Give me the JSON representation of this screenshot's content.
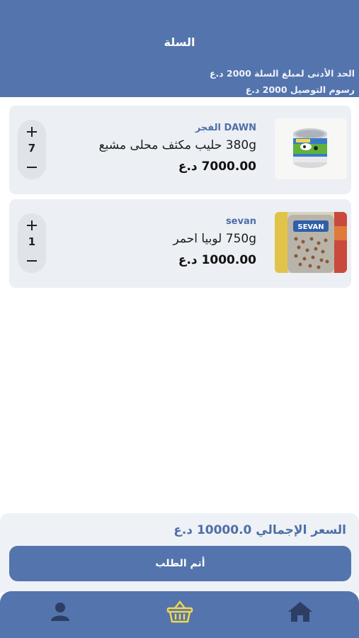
{
  "header": {
    "title": "السلة",
    "min_order": "الحد الأدنى لمبلغ السلة 2000 د.ع",
    "delivery_fee": "رسوم التوصيل 2000 د.ع"
  },
  "cart": {
    "items": [
      {
        "brand": "DAWN الفجر",
        "name": "380g حليب مكثف محلى مشبع",
        "price": "7000.00 د.ع",
        "quantity": "7",
        "plus_icon": "plus-icon",
        "minus_icon": "minus-icon"
      },
      {
        "brand": "sevan",
        "name": "750g لوبيا احمر",
        "price": "1000.00 د.ع",
        "quantity": "1",
        "plus_icon": "plus-icon",
        "minus_icon": "minus-icon"
      }
    ]
  },
  "summary": {
    "total": "السعر الإجمالي 10000.0 د.ع",
    "checkout_label": "أتم الطلب"
  },
  "nav": {
    "items": [
      {
        "icon": "user-icon"
      },
      {
        "icon": "basket-icon",
        "active": true
      },
      {
        "icon": "home-icon"
      }
    ]
  },
  "colors": {
    "primary": "#5474ad",
    "card_bg": "#eceff4",
    "active_icon": "#f2d84a",
    "nav_icon": "#2c3e63"
  }
}
